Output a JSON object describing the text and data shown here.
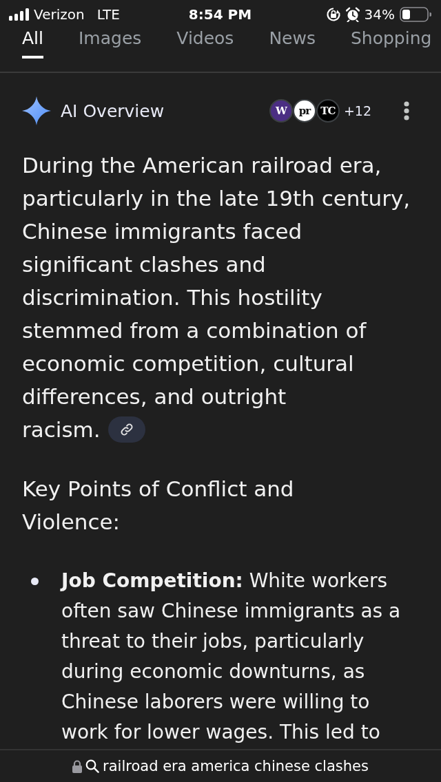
{
  "status_bar": {
    "carrier": "Verizon",
    "network": "LTE",
    "time": "8:54 PM",
    "battery": "34%"
  },
  "tabs": [
    {
      "label": "All",
      "selected": true
    },
    {
      "label": "Images",
      "selected": false
    },
    {
      "label": "Videos",
      "selected": false
    },
    {
      "label": "News",
      "selected": false
    },
    {
      "label": "Shopping",
      "selected": false
    }
  ],
  "ai_overview": {
    "title": "AI Overview",
    "sources": [
      {
        "label": "W",
        "color": "#4b2e83"
      },
      {
        "label": "pr",
        "color": "#ffffff"
      },
      {
        "label": "TC",
        "color": "#000000"
      }
    ],
    "more_sources": "+12",
    "summary": "During the American railroad era, particularly in the late 19th century, Chinese immigrants faced significant clashes and discrimination. This hostility stemmed from a combination of economic competition, cultural differences, and outright racism.",
    "heading": "Key Points of Conflict and Violence:",
    "points": [
      {
        "text": "**Job Competition:** White workers often saw Chinese immigrants as a threat to their jobs, particularly during economic downturns, as Chinese laborers were willing to work for lower wages. This led to"
      }
    ]
  },
  "address_bar": {
    "secure": true,
    "query": "railroad era america chinese clashes"
  }
}
